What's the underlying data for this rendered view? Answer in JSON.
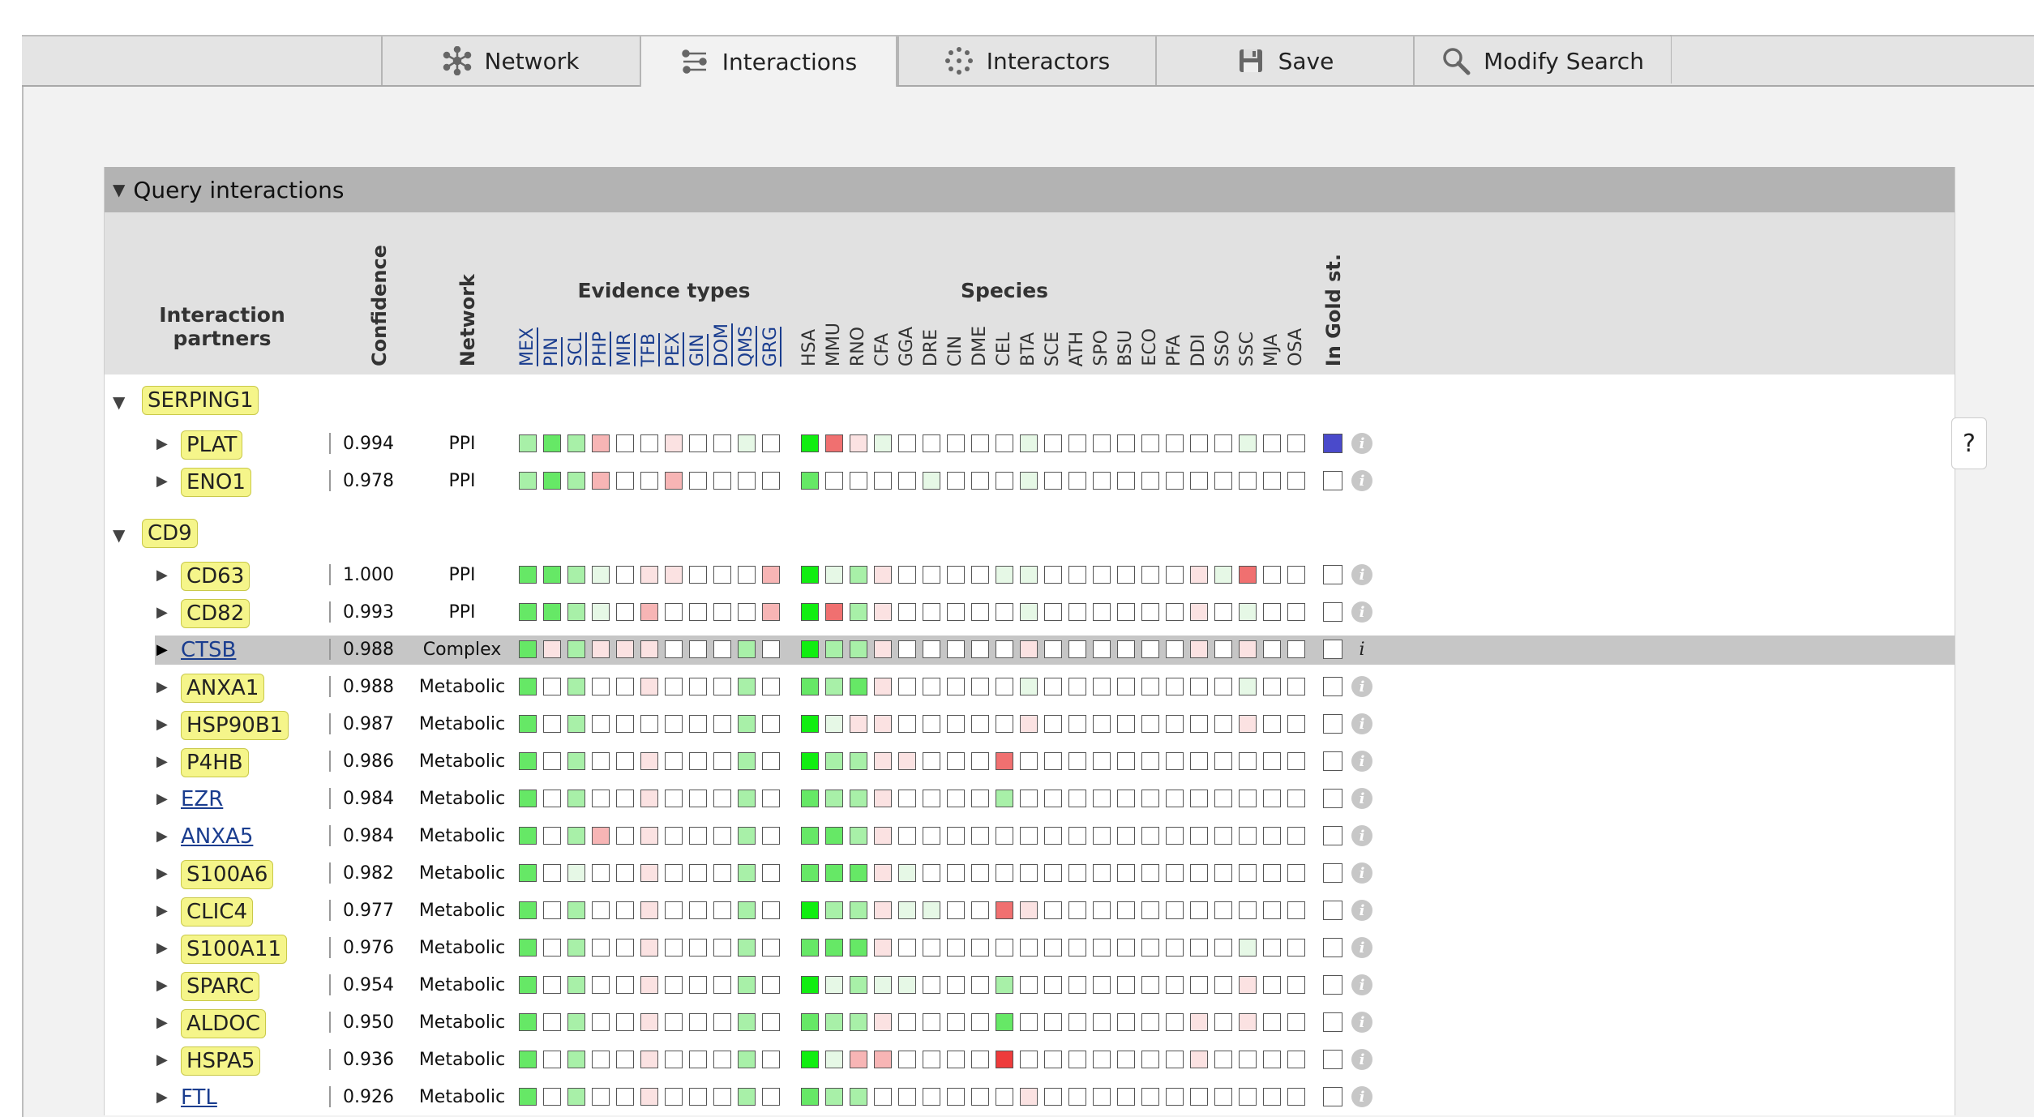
{
  "tabs": [
    {
      "label": "Network",
      "icon": "network-icon",
      "active": false
    },
    {
      "label": "Interactions",
      "icon": "interactions-icon",
      "active": true
    },
    {
      "label": "Interactors",
      "icon": "interactors-icon",
      "active": false
    },
    {
      "label": "Save",
      "icon": "save-icon",
      "active": false
    },
    {
      "label": "Modify Search",
      "icon": "search-icon",
      "active": false
    }
  ],
  "panel": {
    "title": "Query interactions",
    "headers": {
      "partners": "Interaction partners",
      "confidence": "Confidence",
      "network": "Network",
      "evidence": "Evidence types",
      "species": "Species",
      "gold": "In Gold st."
    },
    "evidence_codes": [
      "MEX",
      "PIN",
      "SCL",
      "PHP",
      "MIR",
      "TFB",
      "PEX",
      "GIN",
      "DOM",
      "QMS",
      "GRG"
    ],
    "species_codes": [
      "HSA",
      "MMU",
      "RNO",
      "CFA",
      "GGA",
      "DRE",
      "CIN",
      "DME",
      "CEL",
      "BTA",
      "SCE",
      "ATH",
      "SPO",
      "BSU",
      "ECO",
      "PFA",
      "DDI",
      "SSO",
      "SSC",
      "MJA",
      "OSA"
    ]
  },
  "colors": {
    "g3": "#11ee11",
    "g2": "#66e866",
    "g1": "#a8f0a8",
    "g0": "#e6f8e6",
    "r3": "#ee3b3b",
    "r2": "#f07070",
    "r1": "#f7b5b5",
    "r0": "#fbe2e2",
    "w": "#ffffff",
    "gold_blue": "#4a4acb"
  },
  "groups": [
    {
      "name": "SERPING1",
      "rows": [
        {
          "gene": "PLAT",
          "boxed": true,
          "confidence": "0.994",
          "network": "PPI",
          "evidence": [
            "g1",
            "g2",
            "g1",
            "r1",
            "w",
            "w",
            "r0",
            "w",
            "w",
            "g0",
            "w"
          ],
          "species": [
            "g3",
            "r2",
            "r0",
            "g0",
            "w",
            "w",
            "w",
            "w",
            "w",
            "g0",
            "w",
            "w",
            "w",
            "w",
            "w",
            "w",
            "w",
            "w",
            "g0",
            "w",
            "w"
          ],
          "gold": true
        },
        {
          "gene": "ENO1",
          "boxed": true,
          "confidence": "0.978",
          "network": "PPI",
          "evidence": [
            "g1",
            "g2",
            "g1",
            "r1",
            "w",
            "w",
            "r1",
            "w",
            "w",
            "w",
            "w"
          ],
          "species": [
            "g2",
            "w",
            "w",
            "w",
            "w",
            "g0",
            "w",
            "w",
            "w",
            "g0",
            "w",
            "w",
            "w",
            "w",
            "w",
            "w",
            "w",
            "w",
            "w",
            "w",
            "w"
          ],
          "gold": false
        }
      ]
    },
    {
      "name": "CD9",
      "rows": [
        {
          "gene": "CD63",
          "boxed": true,
          "confidence": "1.000",
          "network": "PPI",
          "evidence": [
            "g2",
            "g2",
            "g1",
            "g0",
            "w",
            "r0",
            "r0",
            "w",
            "w",
            "w",
            "r1"
          ],
          "species": [
            "g3",
            "g0",
            "g1",
            "r0",
            "w",
            "w",
            "w",
            "w",
            "g0",
            "g0",
            "w",
            "w",
            "w",
            "w",
            "w",
            "w",
            "r0",
            "g0",
            "r2",
            "w",
            "w"
          ],
          "gold": false
        },
        {
          "gene": "CD82",
          "boxed": true,
          "confidence": "0.993",
          "network": "PPI",
          "evidence": [
            "g2",
            "g2",
            "g1",
            "g0",
            "w",
            "r1",
            "w",
            "w",
            "w",
            "w",
            "r1"
          ],
          "species": [
            "g3",
            "r2",
            "g1",
            "r0",
            "w",
            "w",
            "w",
            "w",
            "w",
            "g0",
            "w",
            "w",
            "w",
            "w",
            "w",
            "w",
            "r0",
            "w",
            "g0",
            "w",
            "w"
          ],
          "gold": false
        },
        {
          "gene": "CTSB",
          "boxed": false,
          "highlight": true,
          "confidence": "0.988",
          "network": "Complex",
          "evidence": [
            "g2",
            "r0",
            "g1",
            "r0",
            "r0",
            "r0",
            "w",
            "w",
            "w",
            "g1",
            "w"
          ],
          "species": [
            "g3",
            "g1",
            "g1",
            "r0",
            "w",
            "w",
            "w",
            "w",
            "w",
            "r0",
            "w",
            "w",
            "w",
            "w",
            "w",
            "w",
            "r0",
            "w",
            "r0",
            "w",
            "w"
          ],
          "gold": false
        },
        {
          "gene": "ANXA1",
          "boxed": true,
          "confidence": "0.988",
          "network": "Metabolic",
          "evidence": [
            "g2",
            "w",
            "g1",
            "w",
            "w",
            "r0",
            "w",
            "w",
            "w",
            "g1",
            "w"
          ],
          "species": [
            "g2",
            "g1",
            "g2",
            "r0",
            "w",
            "w",
            "w",
            "w",
            "w",
            "g0",
            "w",
            "w",
            "w",
            "w",
            "w",
            "w",
            "w",
            "w",
            "g0",
            "w",
            "w"
          ],
          "gold": false
        },
        {
          "gene": "HSP90B1",
          "boxed": true,
          "confidence": "0.987",
          "network": "Metabolic",
          "evidence": [
            "g2",
            "w",
            "g1",
            "w",
            "w",
            "w",
            "w",
            "w",
            "w",
            "g1",
            "w"
          ],
          "species": [
            "g3",
            "g0",
            "r0",
            "r0",
            "w",
            "w",
            "w",
            "w",
            "w",
            "r0",
            "w",
            "w",
            "w",
            "w",
            "w",
            "w",
            "w",
            "w",
            "r0",
            "w",
            "w"
          ],
          "gold": false
        },
        {
          "gene": "P4HB",
          "boxed": true,
          "confidence": "0.986",
          "network": "Metabolic",
          "evidence": [
            "g2",
            "w",
            "g1",
            "w",
            "w",
            "r0",
            "w",
            "w",
            "w",
            "g1",
            "w"
          ],
          "species": [
            "g3",
            "g1",
            "g1",
            "r0",
            "r0",
            "w",
            "w",
            "w",
            "r2",
            "w",
            "w",
            "w",
            "w",
            "w",
            "w",
            "w",
            "w",
            "w",
            "w",
            "w",
            "w"
          ],
          "gold": false
        },
        {
          "gene": "EZR",
          "boxed": false,
          "confidence": "0.984",
          "network": "Metabolic",
          "evidence": [
            "g2",
            "w",
            "g1",
            "w",
            "w",
            "r0",
            "w",
            "w",
            "w",
            "g1",
            "w"
          ],
          "species": [
            "g2",
            "g1",
            "g1",
            "r0",
            "w",
            "w",
            "w",
            "w",
            "g1",
            "w",
            "w",
            "w",
            "w",
            "w",
            "w",
            "w",
            "w",
            "w",
            "w",
            "w",
            "w"
          ],
          "gold": false
        },
        {
          "gene": "ANXA5",
          "boxed": false,
          "confidence": "0.984",
          "network": "Metabolic",
          "evidence": [
            "g2",
            "w",
            "g1",
            "r1",
            "w",
            "r0",
            "w",
            "w",
            "w",
            "g1",
            "w"
          ],
          "species": [
            "g2",
            "g2",
            "g1",
            "r0",
            "w",
            "w",
            "w",
            "w",
            "w",
            "w",
            "w",
            "w",
            "w",
            "w",
            "w",
            "w",
            "w",
            "w",
            "w",
            "w",
            "w"
          ],
          "gold": false
        },
        {
          "gene": "S100A6",
          "boxed": true,
          "confidence": "0.982",
          "network": "Metabolic",
          "evidence": [
            "g2",
            "w",
            "g0",
            "w",
            "w",
            "r0",
            "w",
            "w",
            "w",
            "g1",
            "w"
          ],
          "species": [
            "g2",
            "g2",
            "g2",
            "r0",
            "g0",
            "w",
            "w",
            "w",
            "w",
            "w",
            "w",
            "w",
            "w",
            "w",
            "w",
            "w",
            "w",
            "w",
            "w",
            "w",
            "w"
          ],
          "gold": false
        },
        {
          "gene": "CLIC4",
          "boxed": true,
          "confidence": "0.977",
          "network": "Metabolic",
          "evidence": [
            "g2",
            "w",
            "g1",
            "w",
            "w",
            "r0",
            "w",
            "w",
            "w",
            "g1",
            "w"
          ],
          "species": [
            "g3",
            "g1",
            "g1",
            "r0",
            "g0",
            "g0",
            "w",
            "w",
            "r2",
            "r0",
            "w",
            "w",
            "w",
            "w",
            "w",
            "w",
            "w",
            "w",
            "w",
            "w",
            "w"
          ],
          "gold": false
        },
        {
          "gene": "S100A11",
          "boxed": true,
          "confidence": "0.976",
          "network": "Metabolic",
          "evidence": [
            "g2",
            "w",
            "g1",
            "w",
            "w",
            "r0",
            "w",
            "w",
            "w",
            "g1",
            "w"
          ],
          "species": [
            "g2",
            "g2",
            "g2",
            "r0",
            "w",
            "w",
            "w",
            "w",
            "w",
            "w",
            "w",
            "w",
            "w",
            "w",
            "w",
            "w",
            "w",
            "w",
            "g0",
            "w",
            "w"
          ],
          "gold": false
        },
        {
          "gene": "SPARC",
          "boxed": true,
          "confidence": "0.954",
          "network": "Metabolic",
          "evidence": [
            "g2",
            "w",
            "g1",
            "w",
            "w",
            "r0",
            "w",
            "w",
            "w",
            "g1",
            "w"
          ],
          "species": [
            "g3",
            "g0",
            "g1",
            "g0",
            "g0",
            "w",
            "w",
            "w",
            "g1",
            "w",
            "w",
            "w",
            "w",
            "w",
            "w",
            "w",
            "w",
            "w",
            "r0",
            "w",
            "w"
          ],
          "gold": false
        },
        {
          "gene": "ALDOC",
          "boxed": true,
          "confidence": "0.950",
          "network": "Metabolic",
          "evidence": [
            "g2",
            "w",
            "g1",
            "w",
            "w",
            "r0",
            "w",
            "w",
            "w",
            "g1",
            "w"
          ],
          "species": [
            "g2",
            "g1",
            "g1",
            "r0",
            "w",
            "w",
            "w",
            "w",
            "g2",
            "w",
            "w",
            "w",
            "w",
            "w",
            "w",
            "w",
            "r0",
            "w",
            "r0",
            "w",
            "w"
          ],
          "gold": false
        },
        {
          "gene": "HSPA5",
          "boxed": true,
          "confidence": "0.936",
          "network": "Metabolic",
          "evidence": [
            "g2",
            "w",
            "g1",
            "w",
            "w",
            "r0",
            "w",
            "w",
            "w",
            "g1",
            "w"
          ],
          "species": [
            "g3",
            "g0",
            "r1",
            "r1",
            "w",
            "w",
            "w",
            "w",
            "r3",
            "w",
            "w",
            "w",
            "w",
            "w",
            "w",
            "w",
            "r0",
            "w",
            "w",
            "w",
            "w"
          ],
          "gold": false
        },
        {
          "gene": "FTL",
          "boxed": false,
          "confidence": "0.926",
          "network": "Metabolic",
          "evidence": [
            "g2",
            "w",
            "g1",
            "w",
            "w",
            "r0",
            "w",
            "w",
            "w",
            "g1",
            "w"
          ],
          "species": [
            "g2",
            "g1",
            "g1",
            "w",
            "w",
            "w",
            "w",
            "w",
            "w",
            "r0",
            "w",
            "w",
            "w",
            "w",
            "w",
            "w",
            "w",
            "w",
            "w",
            "w",
            "w"
          ],
          "gold": false
        }
      ]
    }
  ],
  "help_label": "?",
  "info_symbol": "i"
}
